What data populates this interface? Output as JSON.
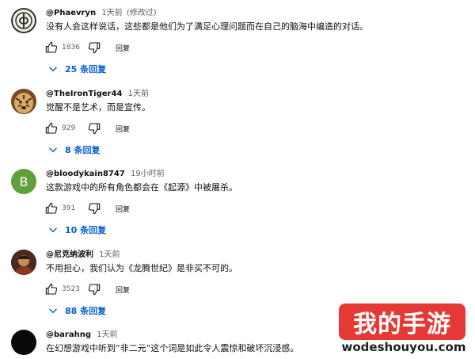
{
  "comments": [
    {
      "author": "@Phaevryn",
      "time": "1天前",
      "edited": "(修改过)",
      "text": "没有人会这样说话，这些都是他们为了满足心理问题而在自己的脑海中编造的对话。",
      "likes": "1836",
      "reply_label": "回复",
      "replies_label": "25 条回复",
      "avatar": {
        "kind": "emblem-icon",
        "bg": "#f2efe3",
        "fg": "#2b2b2b"
      }
    },
    {
      "author": "@TheIronTiger44",
      "time": "1天前",
      "text": "觉醒不是艺术，而是宣传。",
      "likes": "929",
      "reply_label": "回复",
      "replies_label": "8 条回复",
      "avatar": {
        "kind": "tiger-icon",
        "bg": "#8a5a2e",
        "fg": "#d8a868"
      }
    },
    {
      "author": "@bloodykain8747",
      "time": "19小时前",
      "text": "这款游戏中的所有角色都会在《起源》中被屠杀。",
      "likes": "391",
      "reply_label": "回复",
      "replies_label": "10 条回复",
      "avatar": {
        "kind": "letter",
        "letter": "B",
        "bg": "#5fa03d",
        "fg": "#ffffff"
      }
    },
    {
      "author": "@尼克纳波利",
      "time": "1天前",
      "text": "不用担心，我们认为《龙腾世纪》是非买不可的。",
      "likes": "3523",
      "reply_label": "回复",
      "replies_label": "88 条回复",
      "avatar": {
        "kind": "portrait-icon",
        "bg": "#6b3a2a",
        "fg": "#c98a55"
      }
    },
    {
      "author": "@barahng",
      "time": "1天前",
      "text": "在幻想游戏中听到“非二元”这个词是如此令人震惊和破坏沉浸感。",
      "avatar": {
        "kind": "solid",
        "bg": "#0a0a0a",
        "fg": "#0a0a0a"
      }
    }
  ],
  "watermark": {
    "brand": "我的手游",
    "url": "wodeshouyou.com",
    "color": "#e53935"
  },
  "colors": {
    "link": "#065fd4",
    "meta": "#606060"
  }
}
